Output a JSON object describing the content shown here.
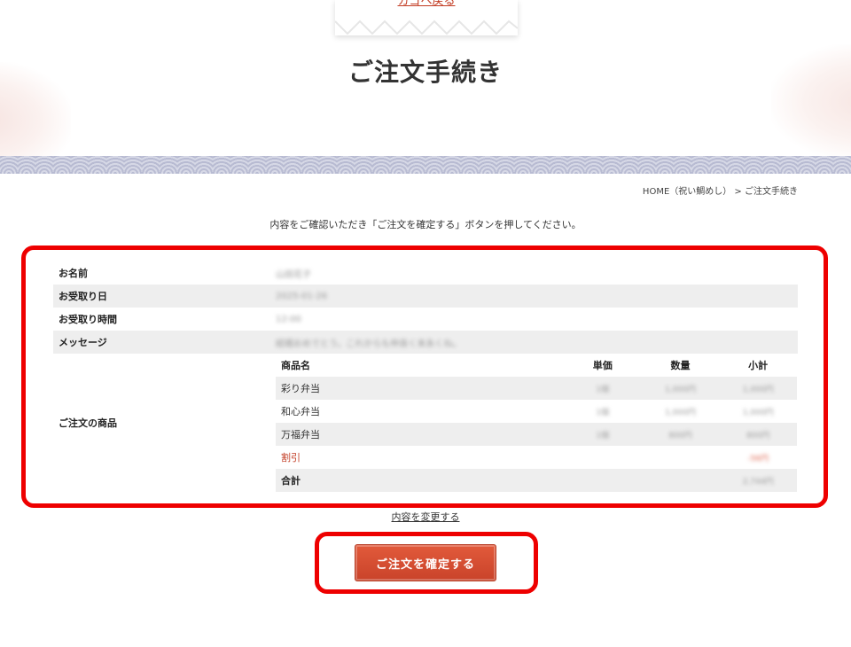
{
  "header": {
    "back_link": "カゴへ戻る",
    "title": "ご注文手続き"
  },
  "breadcrumb": "HOME（祝い鯛めし） > ご注文手続き",
  "instruction": "内容をご確認いただき「ご注文を確定する」ボタンを押してください。",
  "order": {
    "fields": [
      {
        "label": "お名前",
        "value": "山田花子"
      },
      {
        "label": "お受取り日",
        "value": "2025-01-26"
      },
      {
        "label": "お受取り時間",
        "value": "12:00"
      },
      {
        "label": "メッセージ",
        "value": "結婚おめでとう。これからも仲良く末永くね。"
      }
    ],
    "items_label": "ご注文の商品",
    "item_headers": {
      "name": "商品名",
      "price": "単価",
      "qty": "数量",
      "subtotal": "小計"
    },
    "items": [
      {
        "name": "彩り弁当",
        "price": "1個",
        "qty": "1,000円",
        "subtotal": "1,000円"
      },
      {
        "name": "和心弁当",
        "price": "1個",
        "qty": "1,000円",
        "subtotal": "1,000円"
      },
      {
        "name": "万福弁当",
        "price": "1個",
        "qty": "800円",
        "subtotal": "800円"
      }
    ],
    "discount": {
      "name": "割引",
      "subtotal": "-56円"
    },
    "total": {
      "name": "合計",
      "subtotal": "2,744円"
    }
  },
  "change_link": "内容を変更する",
  "confirm_button": "ご注文を確定する",
  "colors": {
    "accent": "#c9432a",
    "highlight": "#ee0000",
    "band": "#c7c9dc"
  }
}
